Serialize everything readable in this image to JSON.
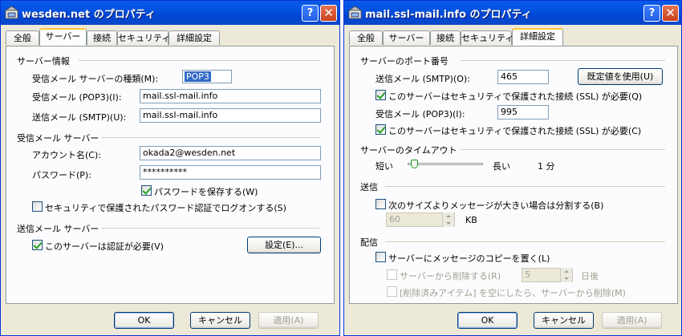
{
  "window1": {
    "title": "wesden.net のプロパティ",
    "tabs": [
      "全般",
      "サーバー",
      "接続",
      "セキュリティ",
      "詳細設定"
    ],
    "server_info": {
      "heading": "サーバー情報",
      "incoming_type_label": "受信メール サーバーの種類(M):",
      "incoming_type_value": "POP3",
      "incoming_pop3_label": "受信メール (POP3)(I):",
      "incoming_pop3_value": "mail.ssl-mail.info",
      "outgoing_smtp_label": "送信メール (SMTP)(U):",
      "outgoing_smtp_value": "mail.ssl-mail.info"
    },
    "incoming_server": {
      "heading": "受信メール サーバー",
      "account_label": "アカウント名(C):",
      "account_value": "okada2@wesden.net",
      "password_label": "パスワード(P):",
      "password_value": "**********",
      "save_password_label": "パスワードを保存する(W)",
      "save_password_checked": true,
      "spa_label": "セキュリティで保護されたパスワード認証でログオンする(S)",
      "spa_checked": false
    },
    "outgoing_server": {
      "heading": "送信メール サーバー",
      "auth_label": "このサーバーは認証が必要(V)",
      "auth_checked": true,
      "settings_button": "設定(E)..."
    },
    "buttons": {
      "ok": "OK",
      "cancel": "キャンセル",
      "apply": "適用(A)"
    }
  },
  "window2": {
    "title": "mail.ssl-mail.info のプロパティ",
    "tabs": [
      "全般",
      "サーバー",
      "接続",
      "セキュリティ",
      "詳細設定"
    ],
    "ports": {
      "heading": "サーバーのポート番号",
      "smtp_label": "送信メール (SMTP)(O):",
      "smtp_value": "465",
      "default_button": "既定値を使用(U)",
      "smtp_ssl_label": "このサーバーはセキュリティで保護された接続 (SSL) が必要(Q)",
      "smtp_ssl_checked": true,
      "pop3_label": "受信メール (POP3)(I):",
      "pop3_value": "995",
      "pop3_ssl_label": "このサーバーはセキュリティで保護された接続 (SSL) が必要(C)",
      "pop3_ssl_checked": true
    },
    "timeout": {
      "heading": "サーバーのタイムアウト",
      "short_label": "短い",
      "long_label": "長い",
      "value_label": "1 分",
      "slider_fraction": 0.05
    },
    "sending": {
      "heading": "送信",
      "split_label": "次のサイズよりメッセージが大きい場合は分割する(B)",
      "split_checked": false,
      "split_size": "60",
      "split_unit": "KB"
    },
    "delivery": {
      "heading": "配信",
      "leave_copy_label": "サーバーにメッセージのコピーを置く(L)",
      "leave_copy_checked": false,
      "remove_after_label": "サーバーから削除する(R)",
      "remove_after_days": "5",
      "days_unit": "日後",
      "remove_deleted_label": "[削除済みアイテム] を空にしたら、サーバーから削除(M)"
    },
    "buttons": {
      "ok": "OK",
      "cancel": "キャンセル",
      "apply": "適用(A)"
    }
  }
}
